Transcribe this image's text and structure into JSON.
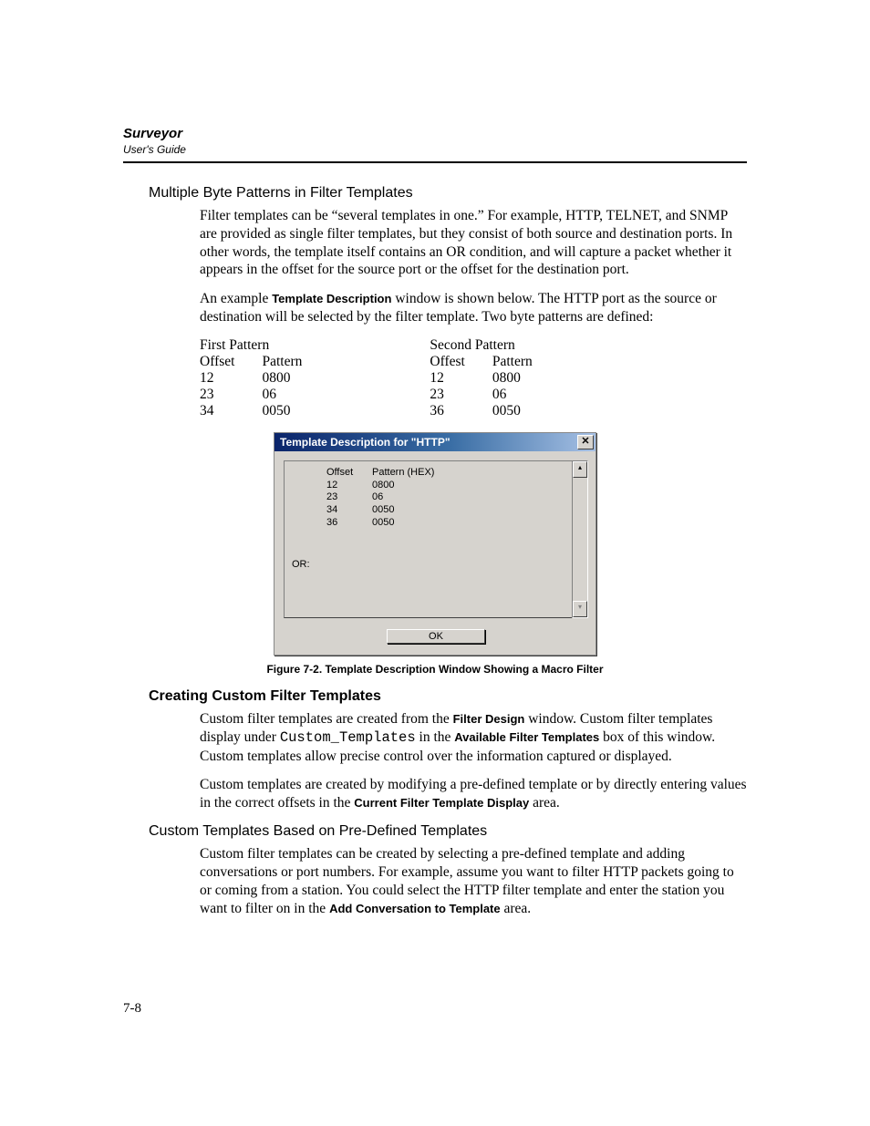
{
  "header": {
    "title": "Surveyor",
    "subtitle": "User's Guide"
  },
  "sec1": {
    "heading": "Multiple Byte Patterns in Filter Templates",
    "p1": "Filter templates can be “several templates in one.” For example, HTTP, TELNET, and SNMP are provided as single filter templates, but they consist of both source and destination ports. In other words, the template itself contains an OR condition, and will capture a packet whether it appears in the offset for the source port or the offset for the destination port.",
    "p2a": "An example ",
    "p2b": "Template Description",
    "p2c": " window is shown below. The HTTP port as the source or destination will be selected by the filter template. Two byte patterns are defined:"
  },
  "patterns": {
    "first": {
      "title": "First Pattern",
      "h_off": "Offset",
      "h_pat": "Pattern",
      "rows": [
        {
          "o": "12",
          "p": "0800"
        },
        {
          "o": "23",
          "p": "06"
        },
        {
          "o": "34",
          "p": "0050"
        }
      ]
    },
    "second": {
      "title": "Second Pattern",
      "h_off": "Offest",
      "h_pat": "Pattern",
      "rows": [
        {
          "o": "12",
          "p": "0800"
        },
        {
          "o": "23",
          "p": "06"
        },
        {
          "o": "36",
          "p": "0050"
        }
      ]
    }
  },
  "dialog": {
    "title": "Template Description for \"HTTP\"",
    "lead": "OR:",
    "h_off": "Offset",
    "h_pat": "Pattern (HEX)",
    "rows": [
      {
        "o": "12",
        "p": "0800"
      },
      {
        "o": "23",
        "p": "06"
      },
      {
        "o": "34",
        "p": "0050"
      },
      {
        "o": "36",
        "p": "0050"
      }
    ],
    "ok": "OK",
    "scroll_up": "▴",
    "scroll_down": "▾"
  },
  "caption": "Figure 7-2.  Template Description Window Showing a Macro Filter",
  "sec2": {
    "heading": "Creating Custom Filter Templates",
    "p1a": "Custom filter templates are created from the ",
    "p1b": "Filter Design",
    "p1c": " window. Custom filter templates display under ",
    "p1d": "Custom_Templates",
    "p1e": " in the ",
    "p1f": "Available Filter Templates",
    "p1g": " box of this window. Custom templates allow precise control over the information captured or displayed.",
    "p2a": "Custom templates are created by modifying a pre-defined template or by directly entering values in the correct offsets in the ",
    "p2b": "Current Filter Template Display",
    "p2c": " area."
  },
  "sec3": {
    "heading": "Custom Templates Based on Pre-Defined Templates",
    "p1a": "Custom filter templates can be created by selecting a pre-defined template and adding conversations or port numbers. For example, assume you want to filter HTTP packets going to or coming from a station. You could select the HTTP filter template and enter the station you want to filter on in the ",
    "p1b": "Add Conversation to Template",
    "p1c": " area."
  },
  "pgnum": "7-8"
}
